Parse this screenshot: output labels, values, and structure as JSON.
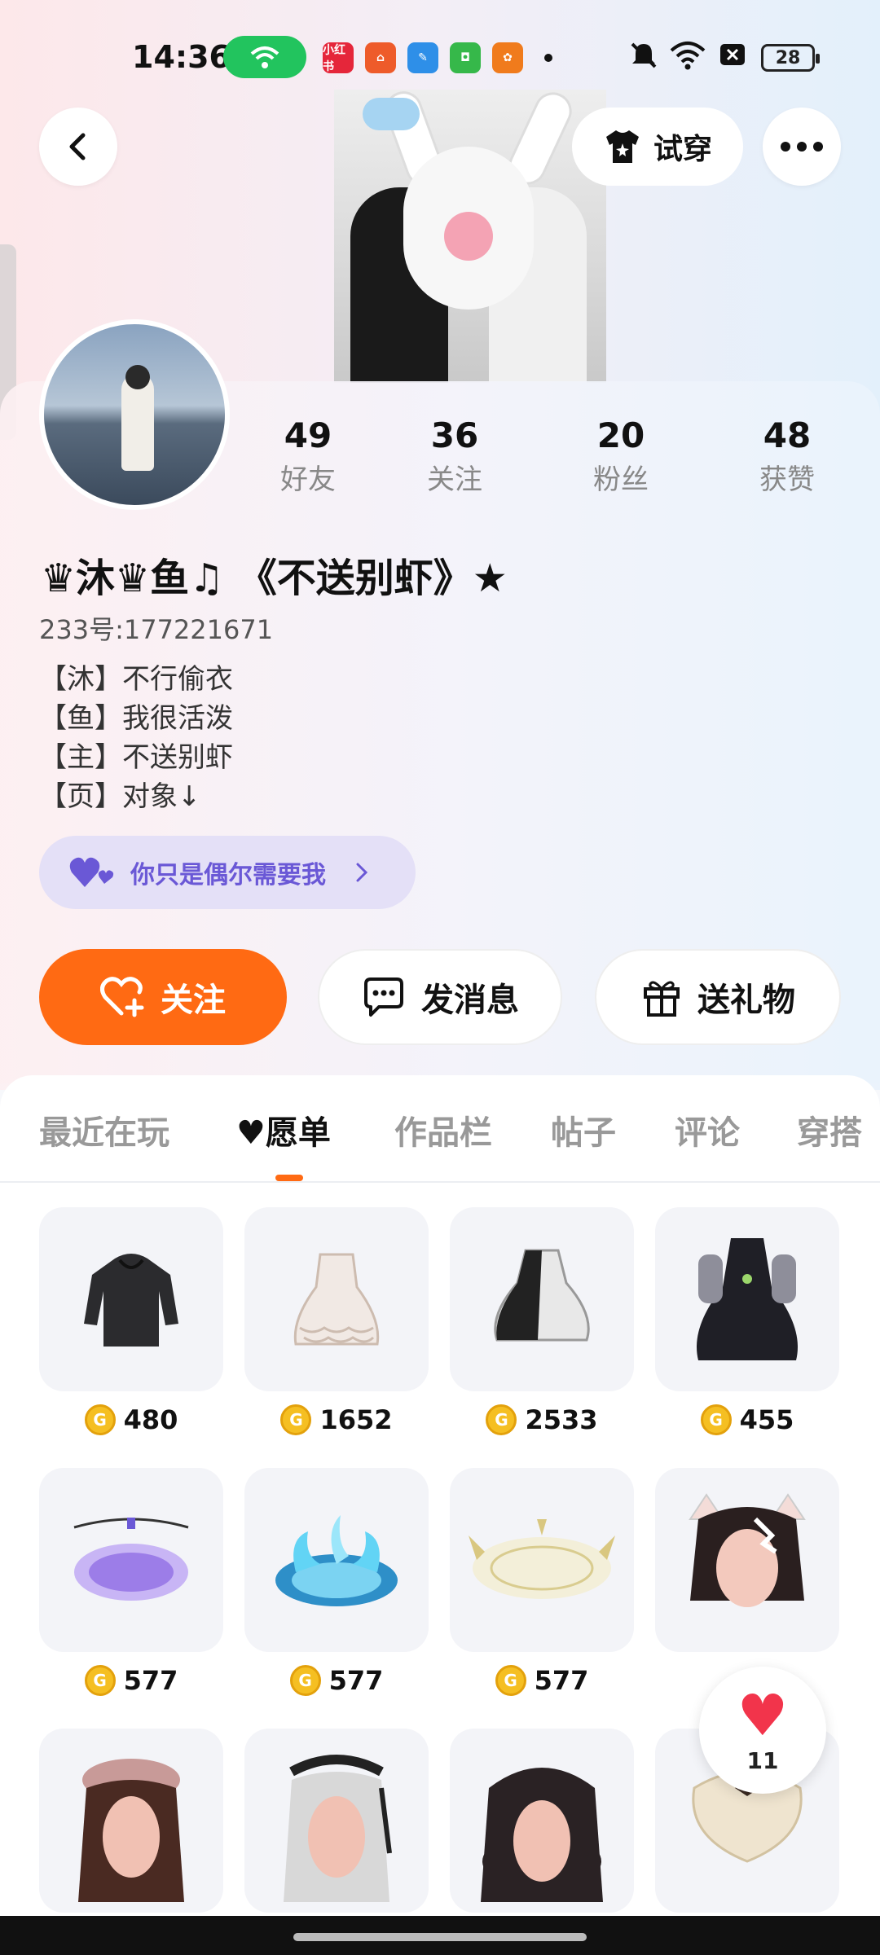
{
  "status_bar": {
    "time": "14:36",
    "battery": "28",
    "app_icons": [
      {
        "name": "xiaohongshu-app-icon",
        "label": "小红书",
        "color": "#e5263a"
      },
      {
        "name": "store-app-icon",
        "label": "",
        "color": "#ee5b2a"
      },
      {
        "name": "feather-app-icon",
        "label": "",
        "color": "#2e8fe8"
      },
      {
        "name": "green-app-icon",
        "label": "",
        "color": "#36b84a"
      },
      {
        "name": "orange-app-icon",
        "label": "",
        "color": "#f07b1c"
      }
    ]
  },
  "header": {
    "try_on_label": "试穿"
  },
  "stats": [
    {
      "num": "49",
      "label": "好友"
    },
    {
      "num": "36",
      "label": "关注"
    },
    {
      "num": "20",
      "label": "粉丝"
    },
    {
      "num": "48",
      "label": "获赞"
    }
  ],
  "profile": {
    "name": "♛沐♛鱼♫ 《不送别虾》★",
    "uid": "233号:177221671",
    "bio": [
      "【沐】不行偷衣",
      "【鱼】我很活泼",
      "【主】不送别虾",
      "【页】对象↓"
    ],
    "tag_text": "你只是偶尔需要我"
  },
  "actions": {
    "follow": "关注",
    "message": "发消息",
    "gift": "送礼物"
  },
  "tabs": [
    {
      "label": "最近在玩"
    },
    {
      "label": "♥愿单"
    },
    {
      "label": "作品栏"
    },
    {
      "label": "帖子"
    },
    {
      "label": "评论"
    },
    {
      "label": "穿搭"
    }
  ],
  "wishlist": [
    {
      "price": "480",
      "item": "black-hoodie"
    },
    {
      "price": "1652",
      "item": "white-lolita-dress"
    },
    {
      "price": "2533",
      "item": "black-white-dress"
    },
    {
      "price": "455",
      "item": "dark-gothic-dress"
    },
    {
      "price": "577",
      "item": "purple-magic-circle"
    },
    {
      "price": "577",
      "item": "blue-flame-circle"
    },
    {
      "price": "577",
      "item": "gold-magic-circle"
    },
    {
      "price": "",
      "item": "cat-ear-hairstyle"
    },
    {
      "price": "",
      "item": "beret-hairstyle"
    },
    {
      "price": "",
      "item": "silver-maid-hairstyle"
    },
    {
      "price": "",
      "item": "curly-black-hairstyle"
    },
    {
      "price": "",
      "item": "cream-ruffle-accessory"
    }
  ],
  "likes": {
    "count": "11"
  },
  "colors": {
    "accent": "#ff6a13",
    "tag_bg": "#e4e0f7",
    "tag_text": "#6a58d6"
  }
}
